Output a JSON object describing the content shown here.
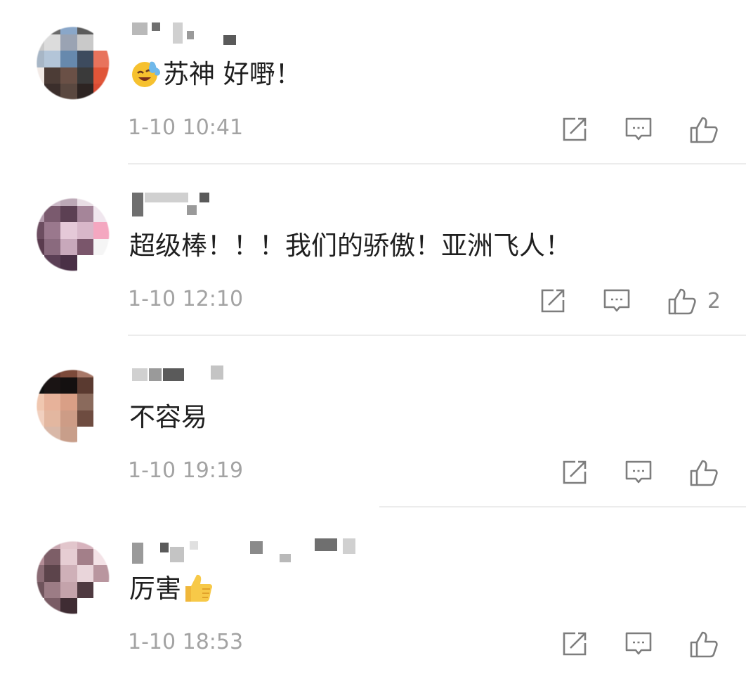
{
  "comments": [
    {
      "text": "苏神 好嘢！",
      "leading_emoji": "laughing-crying-emoji",
      "trailing_emoji": "",
      "time": "1-10 10:41",
      "likes": "",
      "avatar_colors": [
        "#ffffff",
        "#6a6a6a",
        "#8aa7c9",
        "#5b5b5b",
        "#ffffff",
        "#c9c9c9",
        "#dcdcdc",
        "#9aa3b3",
        "#c9c9c9",
        "#ffffff",
        "#a7b6c6",
        "#b3c5d8",
        "#6789ad",
        "#3d4b5e",
        "#e8735c",
        "#f2eae6",
        "#4c3c36",
        "#6a5046",
        "#3a3a3a",
        "#e05538",
        "#ffffff",
        "#3b2e2b",
        "#5a4840",
        "#2d2422",
        "#d94c34"
      ]
    },
    {
      "text": "超级棒！！！我们的骄傲！亚洲飞人！",
      "leading_emoji": "",
      "trailing_emoji": "",
      "time": "1-10 12:10",
      "likes": "2",
      "avatar_colors": [
        "#ffffff",
        "#cbb8c6",
        "#bca8b6",
        "#e8dde4",
        "#ffffff",
        "#b39aac",
        "#7a5a6e",
        "#5c4053",
        "#a58599",
        "#f0e6ee",
        "#6c4d60",
        "#9a788d",
        "#e5c9d8",
        "#d8b7c9",
        "#f4a7c0",
        "#5a3b4e",
        "#8a6a7e",
        "#c8a8bb",
        "#7a566b",
        "#f5f5f5",
        "#ffffff",
        "#5b3f55",
        "#4a3046",
        "#ffffff",
        "#ffffff"
      ]
    },
    {
      "text": "不容易",
      "leading_emoji": "",
      "trailing_emoji": "",
      "time": "1-10 19:19",
      "likes": "",
      "avatar_colors": [
        "#ffffff",
        "#6a3a32",
        "#7c4a3a",
        "#a87868",
        "#ffffff",
        "#101010",
        "#1a1414",
        "#141010",
        "#5a3a30",
        "#ffffff",
        "#f0c7b0",
        "#e7b29a",
        "#d99f86",
        "#8a6a5c",
        "#ffffff",
        "#f1d0bf",
        "#e3b7a0",
        "#cd9c86",
        "#6e4c40",
        "#ffffff",
        "#e8dad2",
        "#d9b8a8",
        "#c89e8a",
        "#ffffff",
        "#ffffff"
      ]
    },
    {
      "text": "厉害",
      "leading_emoji": "",
      "trailing_emoji": "thumbs-up-emoji",
      "time": "1-10 18:53",
      "likes": "",
      "avatar_colors": [
        "#ffffff",
        "#c9a8b1",
        "#e2c6cc",
        "#d7b3bd",
        "#ffffff",
        "#b28b95",
        "#7d5e67",
        "#e6cdd3",
        "#a37f89",
        "#f3e2e6",
        "#8a6b74",
        "#5c444b",
        "#cfb0b8",
        "#e9d5da",
        "#b9969f",
        "#6f545c",
        "#9c7c85",
        "#c4a3ab",
        "#4f3a41",
        "#ffffff",
        "#ffffff",
        "#7a5c65",
        "#3f2c33",
        "#ffffff",
        "#ffffff"
      ]
    }
  ],
  "icons": {
    "share": "share-icon",
    "comment": "comment-icon",
    "like": "like-thumb-icon"
  },
  "colors": {
    "text": "#1f1f1f",
    "meta": "#a3a3a3",
    "icon": "#7d7d7d",
    "divider": "#ececec"
  }
}
